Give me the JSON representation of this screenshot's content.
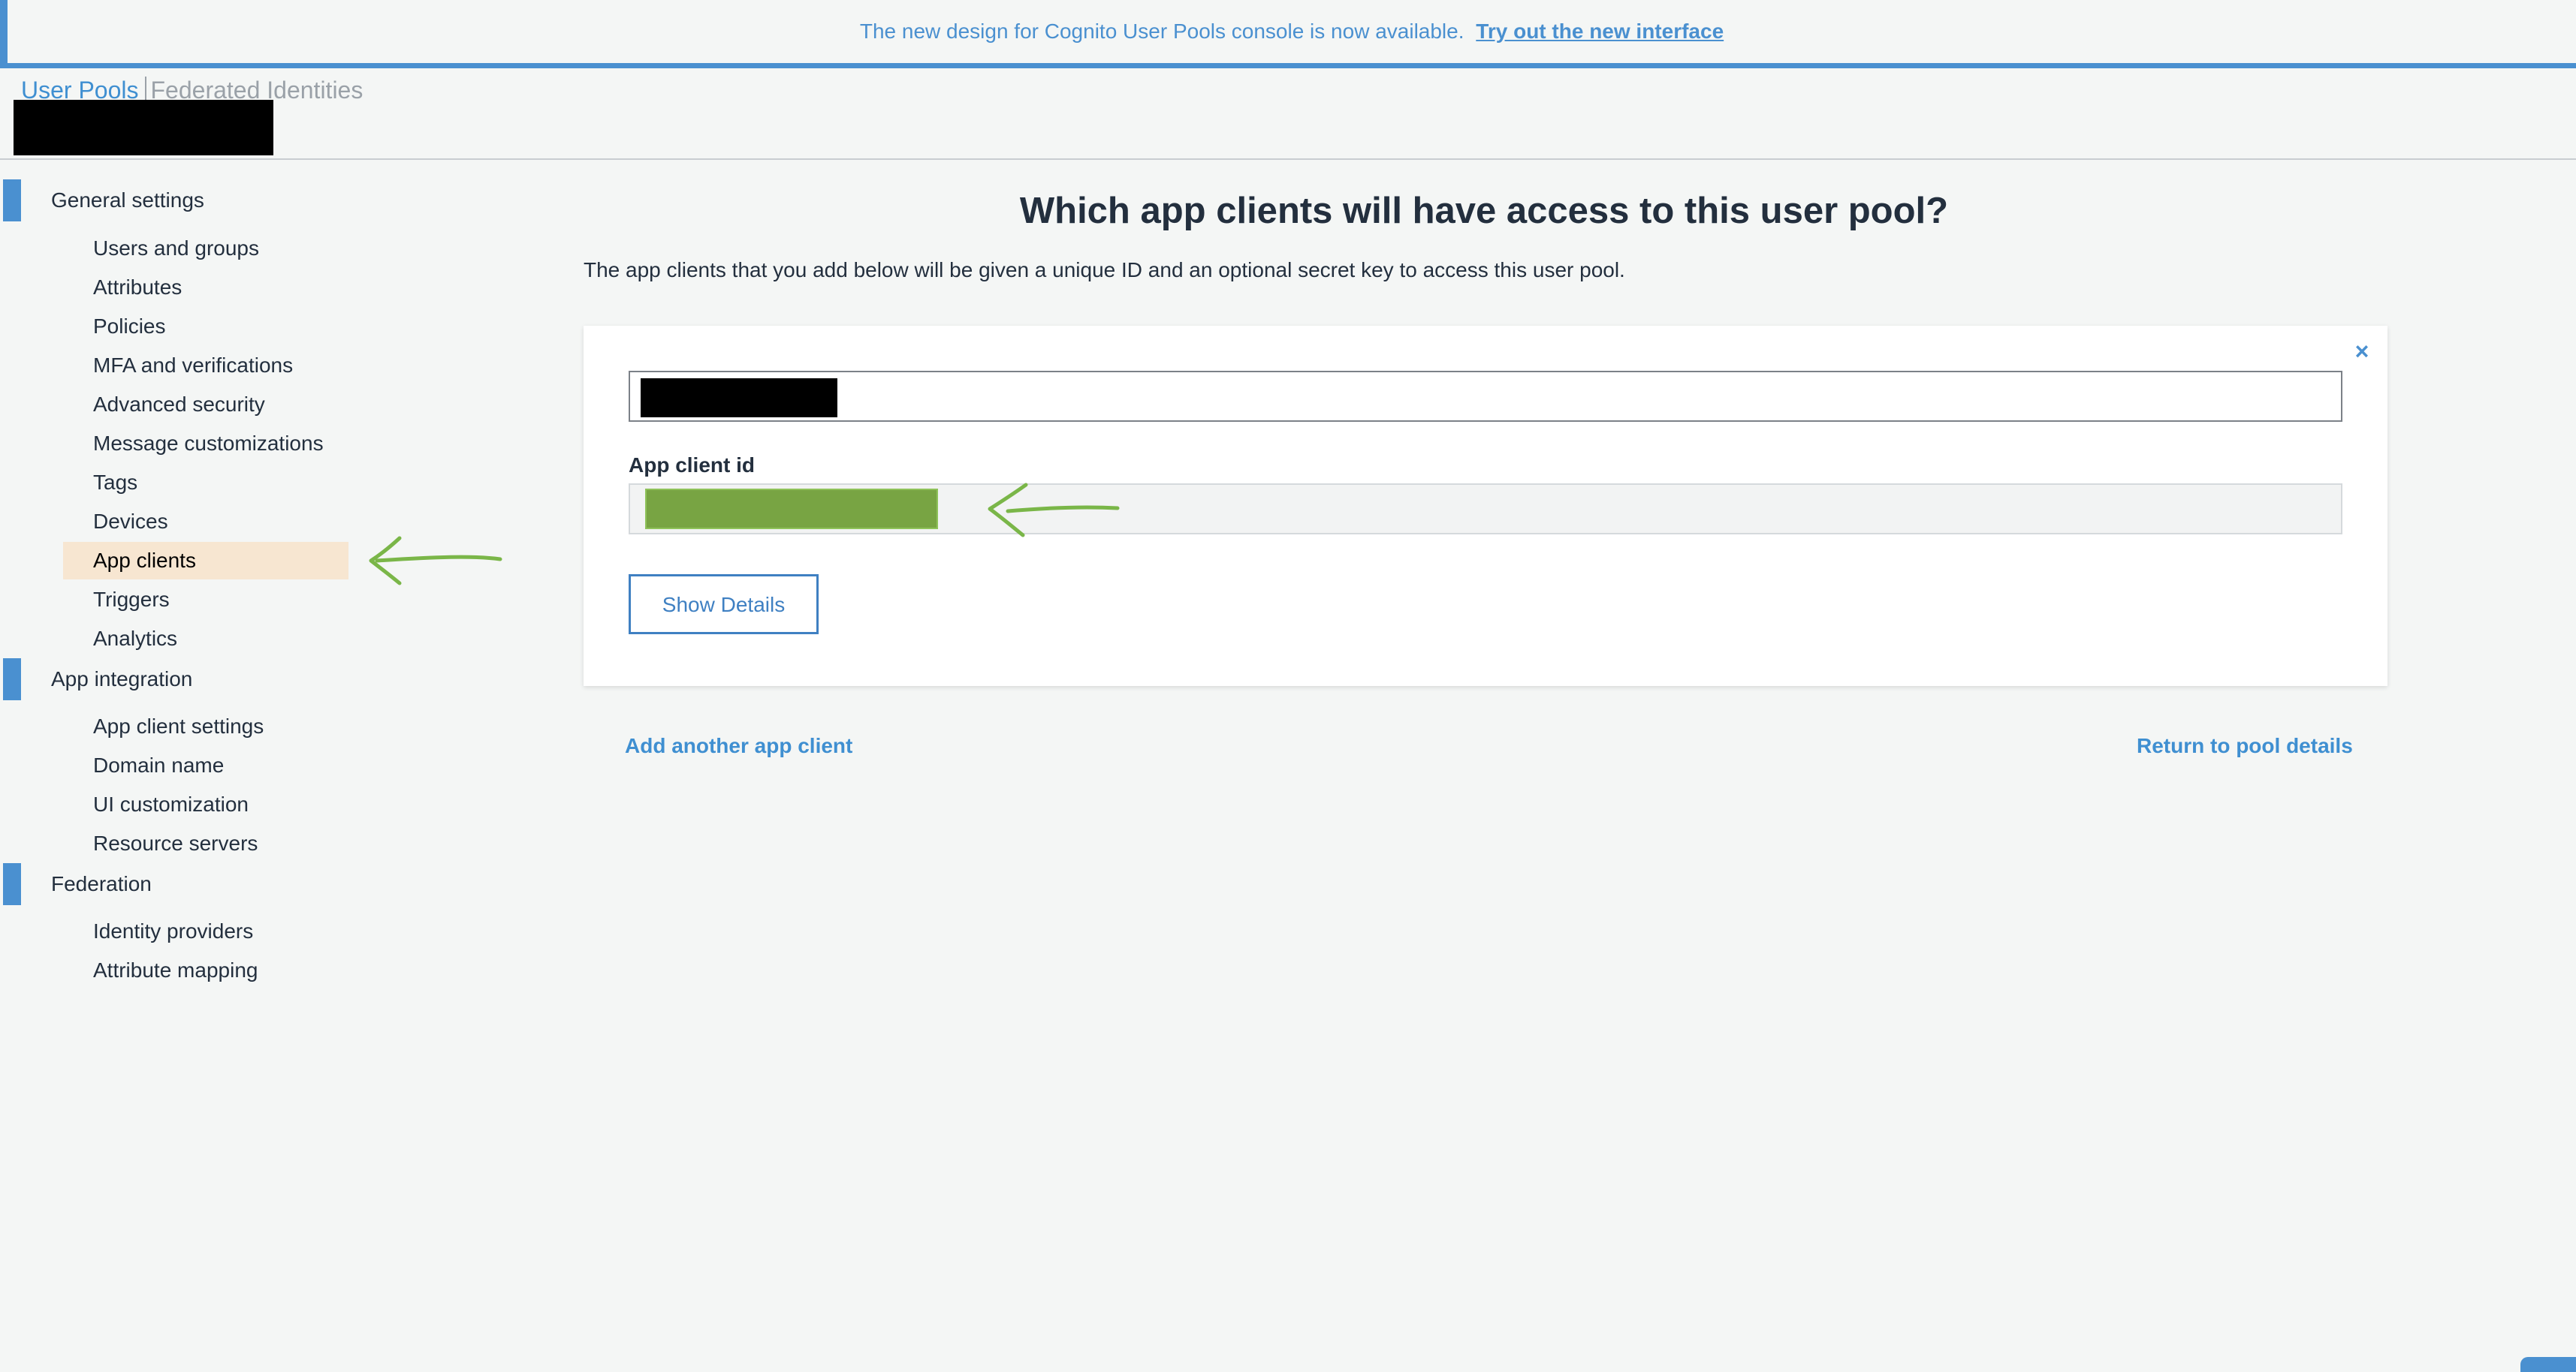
{
  "banner": {
    "message": "The new design for Cognito User Pools console is now available.",
    "link_label": "Try out the new interface"
  },
  "header": {
    "tabs": [
      {
        "label": "User Pools",
        "active": true
      },
      {
        "label": "Federated Identities",
        "active": false
      }
    ]
  },
  "sidebar": {
    "sections": [
      {
        "label": "General settings",
        "items": [
          {
            "label": "Users and groups"
          },
          {
            "label": "Attributes"
          },
          {
            "label": "Policies"
          },
          {
            "label": "MFA and verifications"
          },
          {
            "label": "Advanced security"
          },
          {
            "label": "Message customizations"
          },
          {
            "label": "Tags"
          },
          {
            "label": "Devices"
          },
          {
            "label": "App clients",
            "selected": true
          },
          {
            "label": "Triggers"
          },
          {
            "label": "Analytics"
          }
        ]
      },
      {
        "label": "App integration",
        "items": [
          {
            "label": "App client settings"
          },
          {
            "label": "Domain name"
          },
          {
            "label": "UI customization"
          },
          {
            "label": "Resource servers"
          }
        ]
      },
      {
        "label": "Federation",
        "items": [
          {
            "label": "Identity providers"
          },
          {
            "label": "Attribute mapping"
          }
        ]
      }
    ]
  },
  "main": {
    "title": "Which app clients will have access to this user pool?",
    "description": "The app clients that you add below will be given a unique ID and an optional secret key to access this user pool.",
    "client_card": {
      "close_glyph": "×",
      "client_id_label": "App client id",
      "show_details_label": "Show Details"
    },
    "add_client_label": "Add another app client",
    "return_label": "Return to pool details"
  },
  "colors": {
    "accent": "#4a90d0",
    "selected_bg": "#f7e6d1",
    "annotation_arrow": "#7ab648"
  }
}
